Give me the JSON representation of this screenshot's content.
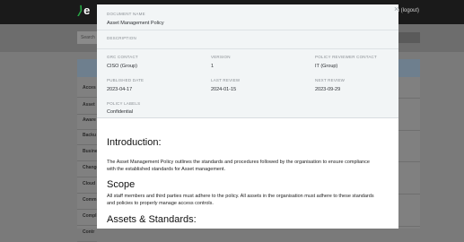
{
  "background": {
    "logo_text": "e",
    "user_text": "n (logout)",
    "search_placeholder": "Search",
    "rows": [
      "Acces",
      "Asset",
      "Aware",
      "Backu",
      "Busine",
      "Change",
      "Cloud",
      "Comm",
      "Compl",
      "Contr"
    ]
  },
  "modal": {
    "close_label": "×",
    "document_name_label": "DOCUMENT NAME",
    "document_name": "Asset Management Policy",
    "description_label": "DESCRIPTION",
    "grc_contact_label": "GRC CONTACT",
    "grc_contact": "CISO (Group)",
    "version_label": "VERSION",
    "version": "1",
    "reviewer_label": "POLICY REVIEWER CONTACT",
    "reviewer": "IT (Group)",
    "published_label": "PUBLISHED DATE",
    "published": "2023-04-17",
    "last_review_label": "LAST REVIEW",
    "last_review": "2024-01-15",
    "next_review_label": "NEXT REVIEW",
    "next_review": "2023-09-29",
    "labels_label": "POLICY LABELS",
    "labels": "Confidential"
  },
  "content": {
    "intro_heading": "Introduction:",
    "intro_text": "The Asset Management Policy outlines the standards and procedures followed by the organisation to ensure compliance with the established standards for Asset management.",
    "scope_heading": "Scope",
    "scope_text": "All staff members and third parties must adhere to the policy. All assets in the organisation must adhere to these standards and policies to properly manage access controls.",
    "assets_heading": "Assets & Standards:"
  }
}
